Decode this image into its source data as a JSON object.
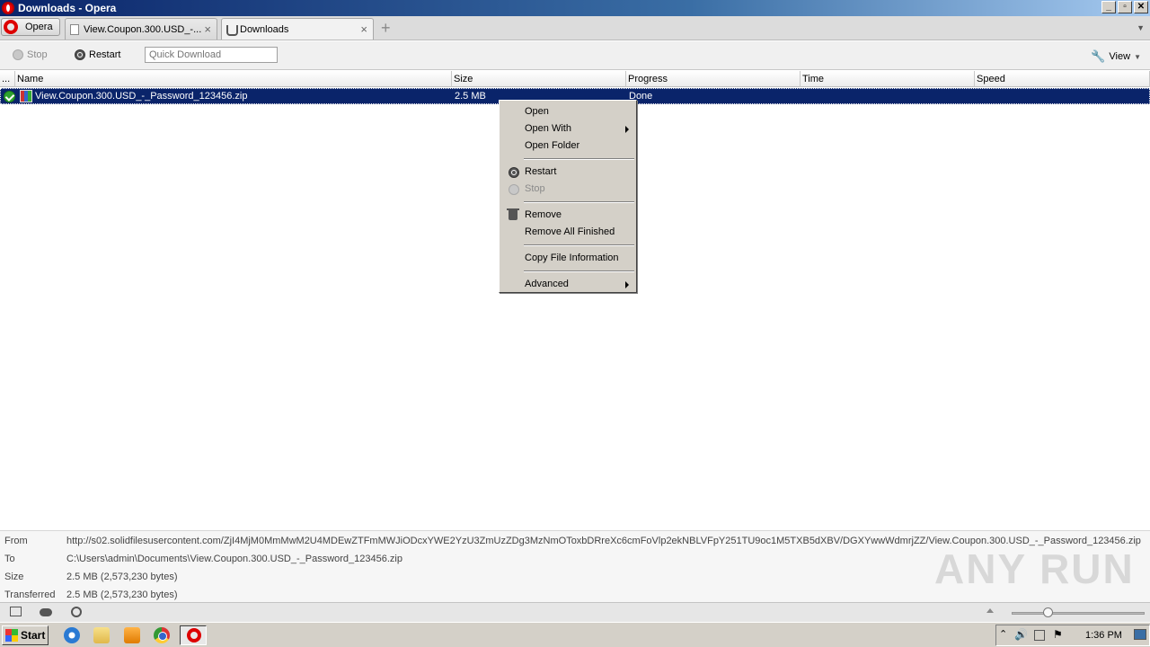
{
  "window": {
    "title": "Downloads - Opera"
  },
  "tabbar": {
    "opera_label": "Opera",
    "tabs": [
      {
        "label": "View.Coupon.300.USD_-...",
        "active": false
      },
      {
        "label": "Downloads",
        "active": true
      }
    ]
  },
  "toolbar": {
    "stop_label": "Stop",
    "restart_label": "Restart",
    "quick_download_placeholder": "Quick Download",
    "view_label": "View"
  },
  "columns": {
    "more": "...",
    "name": "Name",
    "size": "Size",
    "progress": "Progress",
    "time": "Time",
    "speed": "Speed"
  },
  "downloads": [
    {
      "name": "View.Coupon.300.USD_-_Password_123456.zip",
      "size": "2.5 MB",
      "progress": "Done",
      "time": "",
      "speed": ""
    }
  ],
  "context_menu": {
    "items": [
      {
        "label": "Open"
      },
      {
        "label": "Open With"
      },
      {
        "label": "Open Folder"
      },
      {
        "label": "Restart"
      },
      {
        "label": "Stop"
      },
      {
        "label": "Remove"
      },
      {
        "label": "Remove All Finished"
      },
      {
        "label": "Copy File Information"
      },
      {
        "label": "Advanced"
      }
    ]
  },
  "details": {
    "from_label": "From",
    "from_value": "http://s02.solidfilesusercontent.com/ZjI4MjM0MmMwM2U4MDEwZTFmMWJiODcxYWE2YzU3ZmUzZDg3MzNmOToxbDRreXc6cmFoVlp2ekNBLVFpY251TU9oc1M5TXB5dXBV/DGXYwwWdmrjZZ/View.Coupon.300.USD_-_Password_123456.zip",
    "to_label": "To",
    "to_value": "C:\\Users\\admin\\Documents\\View.Coupon.300.USD_-_Password_123456.zip",
    "size_label": "Size",
    "size_value": "2.5 MB (2,573,230 bytes)",
    "transferred_label": "Transferred",
    "transferred_value": "2.5 MB (2,573,230 bytes)"
  },
  "watermark": "ANY RUN",
  "taskbar": {
    "start_label": "Start",
    "clock": "1:36 PM"
  },
  "colors": {
    "selection": "#0a246a",
    "menu_bg": "#d4d0c8",
    "opera_red": "#dd0000"
  }
}
